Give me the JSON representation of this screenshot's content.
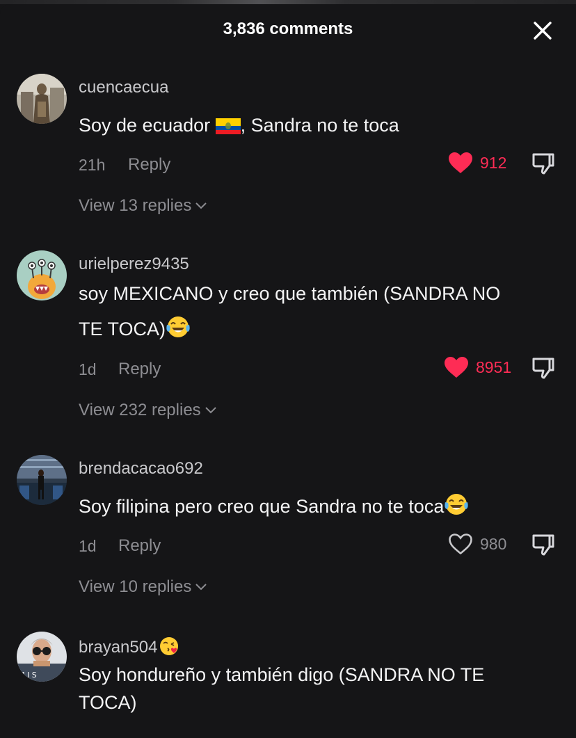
{
  "header": {
    "title": "3,836 comments"
  },
  "colors": {
    "like_active": "#fe2c55",
    "muted": "#8d8d92",
    "background": "#151517"
  },
  "comments": [
    {
      "username": "cuencaecua",
      "text": "Soy de ecuador",
      "text_after_flag": ", Sandra no te toca",
      "time": "21h",
      "reply_label": "Reply",
      "likes": "912",
      "liked": true,
      "view_replies": "View 13 replies"
    },
    {
      "username": "urielperez9435",
      "text_line1": "soy MEXICANO y creo que también (SANDRA NO",
      "text_line2": "TE TOCA)",
      "time": "1d",
      "reply_label": "Reply",
      "likes": "8951",
      "liked": true,
      "view_replies": "View 232 replies"
    },
    {
      "username": "brendacacao692",
      "text": "Soy filipina pero creo que Sandra no te toca",
      "time": "1d",
      "reply_label": "Reply",
      "likes": "980",
      "liked": false,
      "view_replies": "View 10 replies"
    },
    {
      "username": "brayan504",
      "text_line1": "Soy hondureño y también digo (SANDRA NO TE",
      "text_line2": "TOCA)"
    }
  ]
}
